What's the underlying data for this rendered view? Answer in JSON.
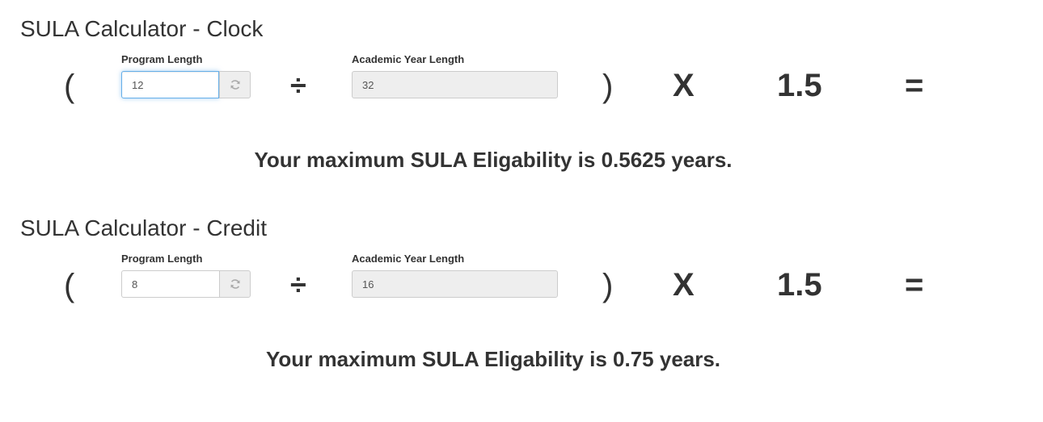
{
  "colors": {
    "text": "#333333",
    "input_border": "#cccccc",
    "readonly_bg": "#eeeeee",
    "focus_border": "#66afe9"
  },
  "operators": {
    "open_paren": "(",
    "divide": "÷",
    "close_paren": ")",
    "times": "X",
    "factor": "1.5",
    "equals": "="
  },
  "calculators": [
    {
      "title": "SULA Calculator - Clock",
      "program_length_label": "Program Length",
      "program_length_value": "12",
      "program_length_focused": true,
      "refresh_icon": "refresh-icon",
      "academic_year_label": "Academic Year Length",
      "academic_year_value": "32",
      "result": "Your maximum SULA Eligability is 0.5625 years."
    },
    {
      "title": "SULA Calculator - Credit",
      "program_length_label": "Program Length",
      "program_length_value": "8",
      "program_length_focused": false,
      "refresh_icon": "refresh-icon",
      "academic_year_label": "Academic Year Length",
      "academic_year_value": "16",
      "result": "Your maximum SULA Eligability is 0.75 years."
    }
  ]
}
